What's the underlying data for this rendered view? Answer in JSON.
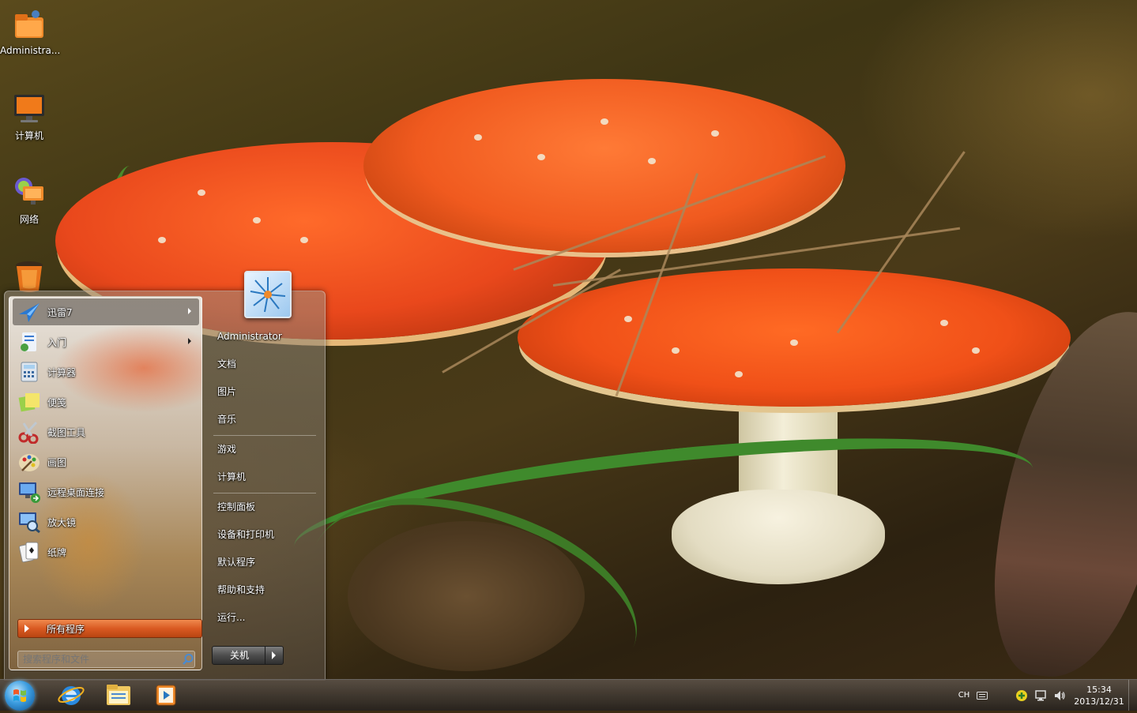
{
  "desktop": {
    "icons": [
      {
        "label": "Administra..."
      },
      {
        "label": "计算机"
      },
      {
        "label": "网络"
      },
      {
        "label": ""
      }
    ]
  },
  "start_menu": {
    "programs": [
      {
        "label": "迅雷7",
        "has_submenu": true
      },
      {
        "label": "入门",
        "has_submenu": true
      },
      {
        "label": "计算器",
        "has_submenu": false
      },
      {
        "label": "便笺",
        "has_submenu": false
      },
      {
        "label": "截图工具",
        "has_submenu": false
      },
      {
        "label": "画图",
        "has_submenu": false
      },
      {
        "label": "远程桌面连接",
        "has_submenu": false
      },
      {
        "label": "放大镜",
        "has_submenu": false
      },
      {
        "label": "纸牌",
        "has_submenu": false
      }
    ],
    "all_programs_label": "所有程序",
    "search_placeholder": "搜索程序和文件",
    "right_links": [
      {
        "label": "Administrator"
      },
      {
        "label": "文档"
      },
      {
        "label": "图片"
      },
      {
        "label": "音乐"
      },
      {
        "label": "游戏"
      },
      {
        "label": "计算机"
      },
      {
        "label": "控制面板"
      },
      {
        "label": "设备和打印机"
      },
      {
        "label": "默认程序"
      },
      {
        "label": "帮助和支持"
      },
      {
        "label": "运行..."
      }
    ],
    "shutdown_label": "关机"
  },
  "taskbar": {
    "pinned": [
      "internet-explorer-icon",
      "windows-explorer-icon",
      "media-player-icon"
    ],
    "tray": {
      "language": "CH",
      "time": "15:34",
      "date": "2013/12/31"
    }
  },
  "colors": {
    "accent_orange": "#d95a22",
    "taskbar": "#3a332c"
  }
}
